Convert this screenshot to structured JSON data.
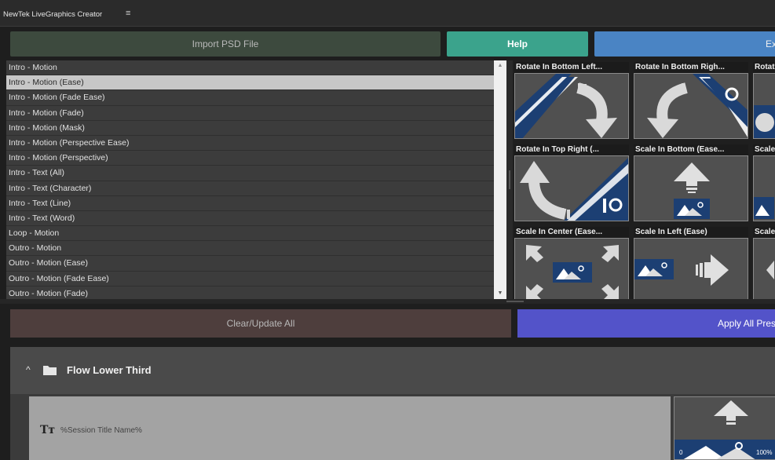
{
  "app": {
    "title": "NewTek LiveGraphics Creator",
    "menu_icon": "hamburger-icon"
  },
  "toolbar": {
    "import_label": "Import PSD File",
    "help_label": "Help",
    "export_label": "Ex"
  },
  "presets": {
    "items": [
      "Intro - Motion",
      "Intro - Motion (Ease)",
      "Intro - Motion (Fade Ease)",
      "Intro - Motion (Fade)",
      "Intro - Motion (Mask)",
      "Intro - Motion (Perspective Ease)",
      "Intro - Motion (Perspective)",
      "Intro - Text (All)",
      "Intro - Text (Character)",
      "Intro - Text (Line)",
      "Intro - Text (Word)",
      "Loop - Motion",
      "Outro - Motion",
      "Outro - Motion (Ease)",
      "Outro - Motion (Fade Ease)",
      "Outro - Motion (Fade)"
    ],
    "selected": "Intro - Motion (Ease)"
  },
  "animations": [
    {
      "label": "Rotate In Bottom Left...",
      "icon": "rotate-in-bottom-left-icon"
    },
    {
      "label": "Rotate In Bottom Righ...",
      "icon": "rotate-in-bottom-right-icon"
    },
    {
      "label": "Rotat",
      "icon": "rotate-icon"
    },
    {
      "label": "Rotate In Top Right (...",
      "icon": "rotate-in-top-right-icon"
    },
    {
      "label": "Scale In Bottom (Ease...",
      "icon": "scale-in-bottom-icon"
    },
    {
      "label": "Scale",
      "icon": "scale-icon"
    },
    {
      "label": "Scale In Center (Ease...",
      "icon": "scale-in-center-icon"
    },
    {
      "label": "Scale In Left (Ease)",
      "icon": "scale-in-left-icon"
    },
    {
      "label": "Scale",
      "icon": "scale-icon"
    }
  ],
  "actions": {
    "clear_label": "Clear/Update All",
    "apply_label": "Apply All Pres"
  },
  "group": {
    "title": "Flow Lower Third",
    "expand_icon": "chevron-up-icon",
    "folder_icon": "folder-icon"
  },
  "layer": {
    "type_icon": "text-icon",
    "type_icon_glyph": "Tт",
    "text": "%Session Title Name%",
    "range_start": "0",
    "range_end": "100%"
  },
  "colors": {
    "help": "#3ba38c",
    "export": "#4a84c4",
    "apply": "#5353c9",
    "import": "#3d4a3e",
    "clear": "#4e3e3d",
    "thumb_accent": "#1c3f73"
  }
}
